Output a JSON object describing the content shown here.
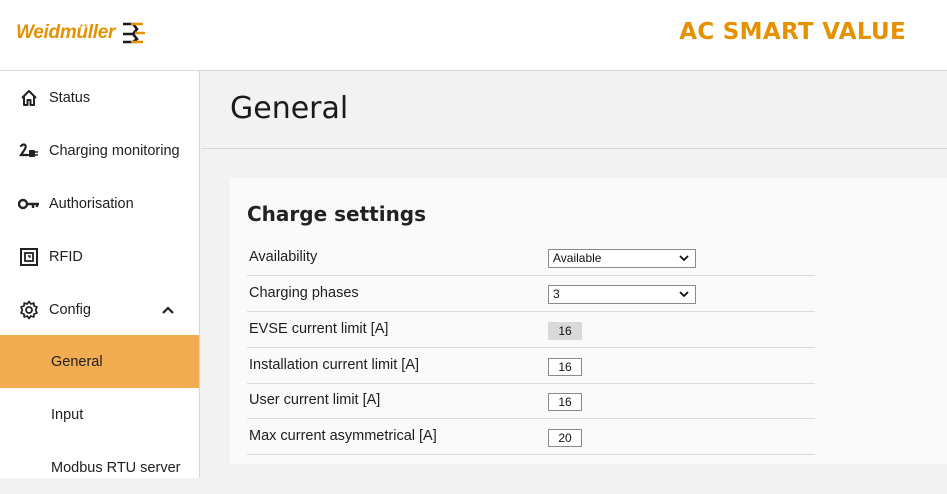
{
  "header": {
    "logo_text": "Weidmüller",
    "product_title": "AC SMART VALUE",
    "brand_color": "#e69100"
  },
  "sidebar": {
    "items": [
      {
        "label": "Status",
        "icon": "home-icon"
      },
      {
        "label": "Charging monitoring",
        "icon": "charging-plug-icon"
      },
      {
        "label": "Authorisation",
        "icon": "key-icon"
      },
      {
        "label": "RFID",
        "icon": "rfid-icon"
      },
      {
        "label": "Config",
        "icon": "gear-icon",
        "expanded": true
      },
      {
        "label": "General",
        "active": true
      },
      {
        "label": "Input"
      },
      {
        "label": "Modbus RTU server"
      }
    ],
    "active_color": "#f2ad52"
  },
  "main": {
    "title": "General",
    "section_title": "Charge settings",
    "rows": [
      {
        "label": "Availability",
        "type": "select",
        "value": "Available"
      },
      {
        "label": "Charging phases",
        "type": "select",
        "value": "3"
      },
      {
        "label": "EVSE current limit [A]",
        "type": "readonly",
        "value": "16"
      },
      {
        "label": "Installation current limit [A]",
        "type": "number",
        "value": "16"
      },
      {
        "label": "User current limit [A]",
        "type": "number",
        "value": "16"
      },
      {
        "label": "Max current asymmetrical [A]",
        "type": "number",
        "value": "20"
      }
    ]
  }
}
